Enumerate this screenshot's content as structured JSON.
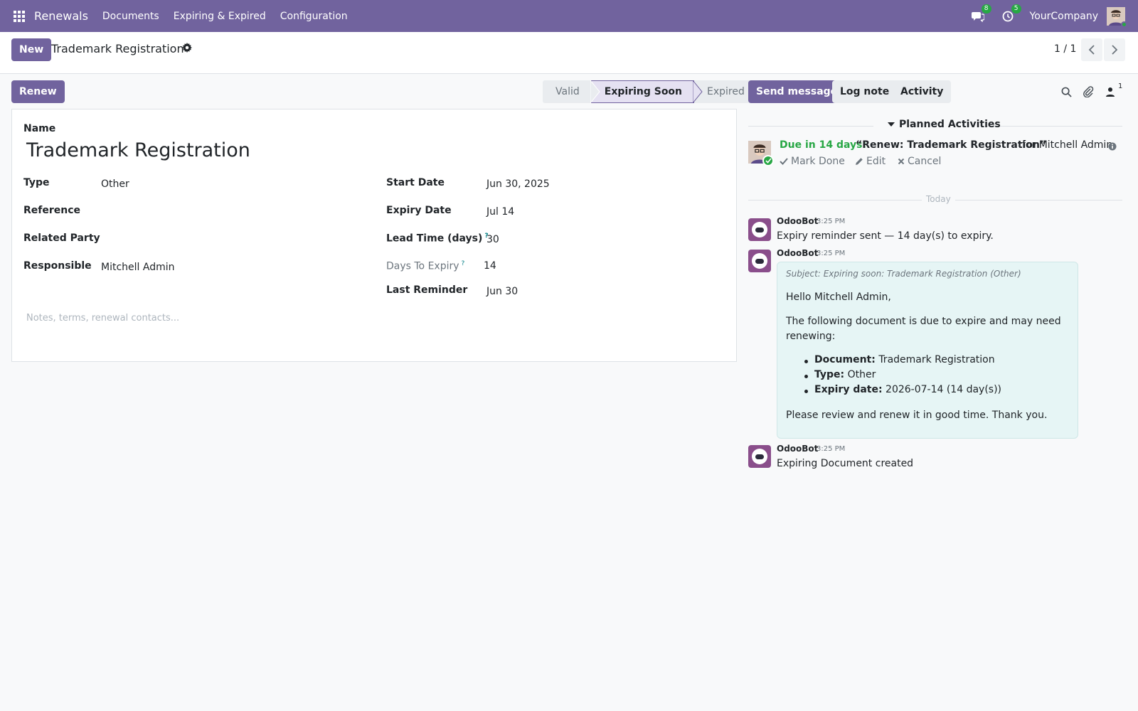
{
  "navbar": {
    "app_name": "Renewals",
    "menu": [
      "Documents",
      "Expiring & Expired",
      "Configuration"
    ],
    "messages_count": "8",
    "activities_count": "5",
    "company": "YourCompany"
  },
  "control_panel": {
    "new_label": "New",
    "record_title": "Trademark Registration",
    "pager": "1 / 1"
  },
  "actions": {
    "renew_label": "Renew"
  },
  "statusbar": {
    "stages": [
      "Valid",
      "Expiring Soon",
      "Expired"
    ],
    "active": "Expiring Soon"
  },
  "form": {
    "name_label": "Name",
    "name_value": "Trademark Registration",
    "type_label": "Type",
    "type_value": "Other",
    "reference_label": "Reference",
    "related_party_label": "Related Party",
    "responsible_label": "Responsible",
    "responsible_value": "Mitchell Admin",
    "start_date_label": "Start Date",
    "start_date_value": "Jun 30, 2025",
    "expiry_date_label": "Expiry Date",
    "expiry_date_value": "Jul 14",
    "lead_time_label": "Lead Time (days)",
    "lead_time_value": "30",
    "days_to_expiry_label": "Days To Expiry",
    "days_to_expiry_value": "14",
    "last_reminder_label": "Last Reminder",
    "last_reminder_value": "Jun 30",
    "help_mark": "?",
    "notes_placeholder": "Notes, terms, renewal contacts..."
  },
  "chatter": {
    "send_message_label": "Send message",
    "log_note_label": "Log note",
    "activity_label": "Activity",
    "followers_count": "1",
    "planned_title": "Planned Activities",
    "activity": {
      "due": "Due in 14 days:",
      "summary": "“Renew: Trademark Registration”",
      "assignee": "for Mitchell Admin",
      "mark_done": "Mark Done",
      "edit": "Edit",
      "cancel": "Cancel"
    },
    "today_label": "Today",
    "messages": [
      {
        "author": "OdooBot",
        "time": "3:25 PM",
        "body": "Expiry reminder sent — 14 day(s) to expiry."
      },
      {
        "author": "OdooBot",
        "time": "3:25 PM",
        "subject": "Subject: Expiring soon: Trademark Registration (Other)",
        "greeting": "Hello Mitchell Admin,",
        "intro_1": "The following document is due to expire and may need",
        "intro_2": "renewing:",
        "items": [
          {
            "label": "Document:",
            "value": "Trademark Registration"
          },
          {
            "label": "Type:",
            "value": "Other"
          },
          {
            "label": "Expiry date:",
            "value": "2026-07-14 (14 day(s))"
          }
        ],
        "closing": "Please review and renew it in good time. Thank you."
      },
      {
        "author": "OdooBot",
        "time": "3:25 PM",
        "body": "Expiring Document created"
      }
    ]
  },
  "colors": {
    "brand": "#71639e",
    "success": "#28a745",
    "mail_bubble": "#e6f5f5"
  }
}
